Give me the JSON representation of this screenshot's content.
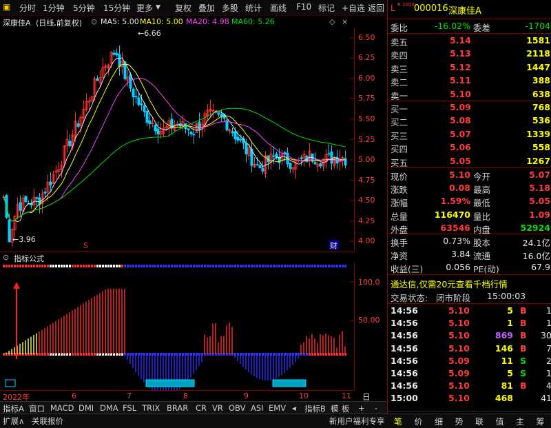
{
  "toolbar": {
    "left": [
      "分时",
      "1分钟",
      "5分钟",
      "15分钟",
      "更多"
    ],
    "right": [
      "复权",
      "叠加",
      "多股",
      "统计",
      "画线",
      "F10",
      "标记",
      "+自选",
      "返回"
    ]
  },
  "header": {
    "name": "深康佳A",
    "mode": "(日线,前复权)",
    "ma5": "MA5: 5.00",
    "ma10": "MA10: 5.00",
    "ma20": "MA20: 4.98",
    "ma60": "MA60: 5.26",
    "colors": {
      "ma5": "#e8e8e8",
      "ma10": "#ffff00",
      "ma20": "#ff40ff",
      "ma60": "#00e000"
    }
  },
  "main_axis": [
    "6.50",
    "6.25",
    "6.00",
    "5.75",
    "5.50",
    "5.25",
    "5.00",
    "4.75",
    "4.50",
    "4.25",
    "4.00"
  ],
  "annotations": {
    "high": "6.66",
    "low": "3.96",
    "s_mark": "S",
    "cai_mark": "财"
  },
  "indicator": {
    "title": "指标公式",
    "axis": [
      "100.0",
      "50.00"
    ]
  },
  "bottom_axis": {
    "year": "2022年",
    "months": [
      "6",
      "7",
      "8",
      "9",
      "10",
      "11"
    ],
    "period": "日线"
  },
  "tabs": [
    "指标A",
    "窗口",
    "MACD",
    "DMI",
    "DMA",
    "FSL",
    "TRIX",
    "BRAR",
    "CR",
    "VR",
    "OBV",
    "ASI",
    "EMV"
  ],
  "tabs_right": [
    "指标B",
    "模",
    "板",
    "+",
    "-"
  ],
  "status": {
    "left1": "扩展∧",
    "left2": "关联报价",
    "promo": "新用户福利专享"
  },
  "panel_tabs": [
    "笔",
    "价",
    "细",
    "势",
    "联",
    "值",
    "主",
    "筹"
  ],
  "stock": {
    "lv": "L",
    "code": "000016",
    "name": "深康佳A",
    "lv2": "R 1000"
  },
  "weibi": {
    "label": "委比",
    "value": "-16.02%",
    "label2": "委差",
    "value2": "-1704"
  },
  "sells": [
    {
      "label": "卖五",
      "price": "5.14",
      "vol": "1581"
    },
    {
      "label": "卖四",
      "price": "5.13",
      "vol": "2118"
    },
    {
      "label": "卖三",
      "price": "5.12",
      "vol": "1447"
    },
    {
      "label": "卖二",
      "price": "5.11",
      "vol": "388"
    },
    {
      "label": "卖一",
      "price": "5.10",
      "vol": "638"
    }
  ],
  "buys": [
    {
      "label": "买一",
      "price": "5.09",
      "vol": "768"
    },
    {
      "label": "买二",
      "price": "5.08",
      "vol": "536"
    },
    {
      "label": "买三",
      "price": "5.07",
      "vol": "1339"
    },
    {
      "label": "买四",
      "price": "5.06",
      "vol": "558"
    },
    {
      "label": "买五",
      "price": "5.05",
      "vol": "1267"
    }
  ],
  "quote": [
    {
      "l1": "现价",
      "v1": "5.10",
      "l2": "今开",
      "v2": "5.07",
      "c1": "red",
      "c2": "red"
    },
    {
      "l1": "涨跌",
      "v1": "0.08",
      "l2": "最高",
      "v2": "5.18",
      "c1": "red",
      "c2": "red"
    },
    {
      "l1": "涨幅",
      "v1": "1.59%",
      "l2": "最低",
      "v2": "5.05",
      "c1": "red",
      "c2": "red"
    },
    {
      "l1": "总量",
      "v1": "116470",
      "l2": "量比",
      "v2": "1.09",
      "c1": "yellow",
      "c2": "red"
    },
    {
      "l1": "外盘",
      "v1": "63546",
      "l2": "内盘",
      "v2": "52924",
      "c1": "red",
      "c2": "green"
    }
  ],
  "quote2": [
    {
      "l1": "换手",
      "v1": "0.73%",
      "l2": "股本",
      "v2": "24.1亿"
    },
    {
      "l1": "净资",
      "v1": "3.84",
      "l2": "流通",
      "v2": "16.0亿"
    },
    {
      "l1": "收益(三)",
      "v1": "0.056",
      "l2": "PE(动)",
      "v2": "67.9"
    }
  ],
  "promo_line": "通达信,仅需20元查看千档行情",
  "trade_state": {
    "label": "交易状态:",
    "state": "闭市阶段",
    "time": "15:00:03"
  },
  "ticks": [
    {
      "t": "14:56",
      "p": "5.10",
      "v": "5",
      "d": "B",
      "n": "1",
      "vc": "yellow",
      "dc": "red"
    },
    {
      "t": "14:56",
      "p": "5.10",
      "v": "1",
      "d": "B",
      "n": "1",
      "vc": "yellow",
      "dc": "red"
    },
    {
      "t": "14:56",
      "p": "5.10",
      "v": "869",
      "d": "B",
      "n": "30",
      "vc": "purple",
      "dc": "red"
    },
    {
      "t": "14:56",
      "p": "5.10",
      "v": "146",
      "d": "B",
      "n": "7",
      "vc": "yellow",
      "dc": "red"
    },
    {
      "t": "14:56",
      "p": "5.09",
      "v": "11",
      "d": "S",
      "n": "2",
      "vc": "yellow",
      "dc": "green"
    },
    {
      "t": "14:56",
      "p": "5.09",
      "v": "5",
      "d": "S",
      "n": "1",
      "vc": "yellow",
      "dc": "green"
    },
    {
      "t": "14:56",
      "p": "5.10",
      "v": "81",
      "d": "B",
      "n": "4",
      "vc": "yellow",
      "dc": "red"
    },
    {
      "t": "15:00",
      "p": "5.10",
      "v": "468",
      "d": "",
      "n": "41",
      "vc": "yellow",
      "dc": "red"
    }
  ]
}
